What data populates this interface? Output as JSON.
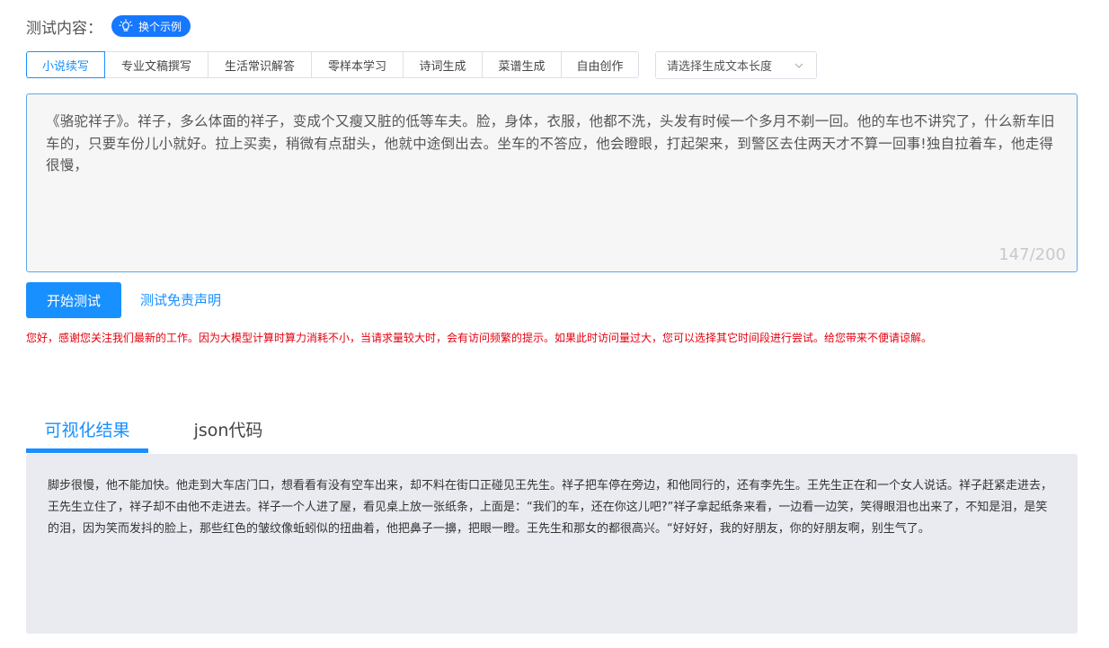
{
  "header": {
    "label": "测试内容：",
    "example_button": "换个示例",
    "example_icon": "lightbulb-icon"
  },
  "mode_tabs": [
    {
      "label": "小说续写",
      "active": true
    },
    {
      "label": "专业文稿撰写",
      "active": false
    },
    {
      "label": "生活常识解答",
      "active": false
    },
    {
      "label": "零样本学习",
      "active": false
    },
    {
      "label": "诗词生成",
      "active": false
    },
    {
      "label": "菜谱生成",
      "active": false
    },
    {
      "label": "自由创作",
      "active": false
    }
  ],
  "length_select": {
    "placeholder": "请选择生成文本长度",
    "icon": "chevron-down-icon"
  },
  "input": {
    "value": "《骆驼祥子》。祥子，多么体面的祥子，变成个又瘦又脏的低等车夫。脸，身体，衣服，他都不洗，头发有时候一个多月不剃一回。他的车也不讲究了，什么新车旧车的，只要车份儿小就好。拉上买卖，稍微有点甜头，他就中途倒出去。坐车的不答应，他会瞪眼，打起架来，到警区去住两天才不算一回事!独自拉着车，他走得很慢，",
    "counter": "147/200"
  },
  "actions": {
    "start_label": "开始测试",
    "disclaimer_label": "测试免责声明"
  },
  "notice": "您好，感谢您关注我们最新的工作。因为大模型计算时算力消耗不小，当请求量较大时，会有访问频繁的提示。如果此时访问量过大，您可以选择其它时间段进行尝试。给您带来不便请谅解。",
  "result_tabs": [
    {
      "label": "可视化结果",
      "active": true
    },
    {
      "label": "json代码",
      "active": false
    }
  ],
  "result": {
    "text": "脚步很慢，他不能加快。他走到大车店门口，想看看有没有空车出来，却不料在街口正碰见王先生。祥子把车停在旁边，和他同行的，还有李先生。王先生正在和一个女人说话。祥子赶紧走进去，王先生立住了，祥子却不由他不走进去。祥子一个人进了屋，看见桌上放一张纸条，上面是：“我们的车，还在你这儿吧?”祥子拿起纸条来看，一边看一边笑，笑得眼泪也出来了，不知是泪，是笑的泪，因为笑而发抖的脸上，那些红色的皱纹像蚯蚓似的扭曲着，他把鼻子一擤，把眼一瞪。王先生和那女的都很高兴。“好好好，我的好朋友，你的好朋友啊，别生气了。"
  },
  "colors": {
    "accent": "#1890ff",
    "notice": "#e5000f",
    "panel_bg": "#e9ebf0"
  }
}
